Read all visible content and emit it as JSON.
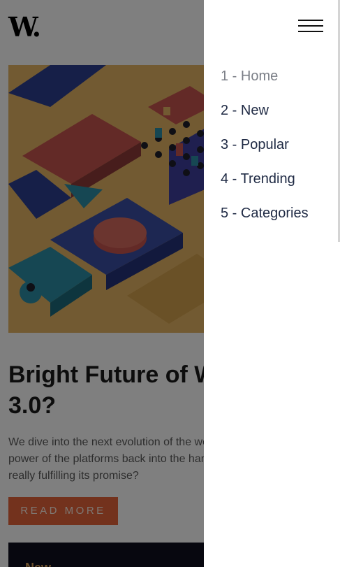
{
  "brand": {
    "logo_text": "W."
  },
  "article": {
    "headline_line1": "Bright Future of Web",
    "headline_line2": "3.0?",
    "excerpt": "We dive into the next evolution of the web that claims to put the power of the platforms back into the hands of the people. But is it really fulfilling its promise?",
    "read_more_label": "READ MORE"
  },
  "next_card": {
    "label": "New"
  },
  "menu": {
    "items": [
      {
        "label": "1 - Home",
        "active": true
      },
      {
        "label": "2 - New",
        "active": false
      },
      {
        "label": "3 - Popular",
        "active": false
      },
      {
        "label": "4 - Trending",
        "active": false
      },
      {
        "label": "5 - Categories",
        "active": false
      }
    ]
  },
  "colors": {
    "accent": "#e7643a",
    "overlay": "rgba(0,0,0,0.5)",
    "menu_text": "#1f2a44"
  }
}
